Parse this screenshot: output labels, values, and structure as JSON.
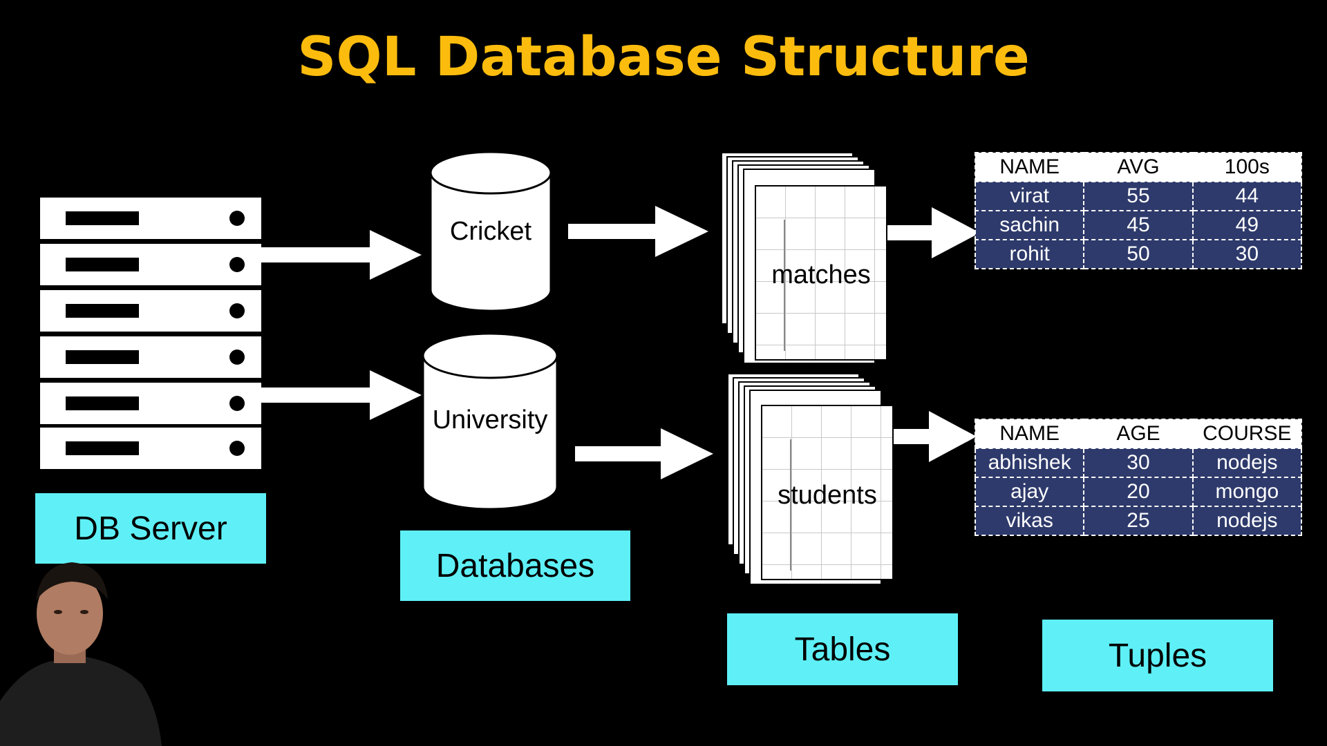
{
  "title": "SQL Database Structure",
  "colors": {
    "title": "#FBBC0E",
    "label_bg": "#5EF0F6",
    "tuple_row_bg": "#2E3A6B",
    "background": "#000000"
  },
  "labels": {
    "db_server": "DB Server",
    "databases": "Databases",
    "tables": "Tables",
    "tuples": "Tuples"
  },
  "databases": [
    {
      "name": "Cricket"
    },
    {
      "name": "University"
    }
  ],
  "tables": [
    {
      "name": "matches"
    },
    {
      "name": "students"
    }
  ],
  "tuple_tables": [
    {
      "headers": [
        "NAME",
        "AVG",
        "100s"
      ],
      "rows": [
        [
          "virat",
          "55",
          "44"
        ],
        [
          "sachin",
          "45",
          "49"
        ],
        [
          "rohit",
          "50",
          "30"
        ]
      ]
    },
    {
      "headers": [
        "NAME",
        "AGE",
        "COURSE"
      ],
      "rows": [
        [
          "abhishek",
          "30",
          "nodejs"
        ],
        [
          "ajay",
          "20",
          "mongo"
        ],
        [
          "vikas",
          "25",
          "nodejs"
        ]
      ]
    }
  ],
  "icons": {
    "server": "server-rack-icon",
    "database": "database-cylinder-icon",
    "table": "table-stack-icon",
    "arrow": "arrow-right-icon",
    "presenter": "presenter-avatar"
  }
}
